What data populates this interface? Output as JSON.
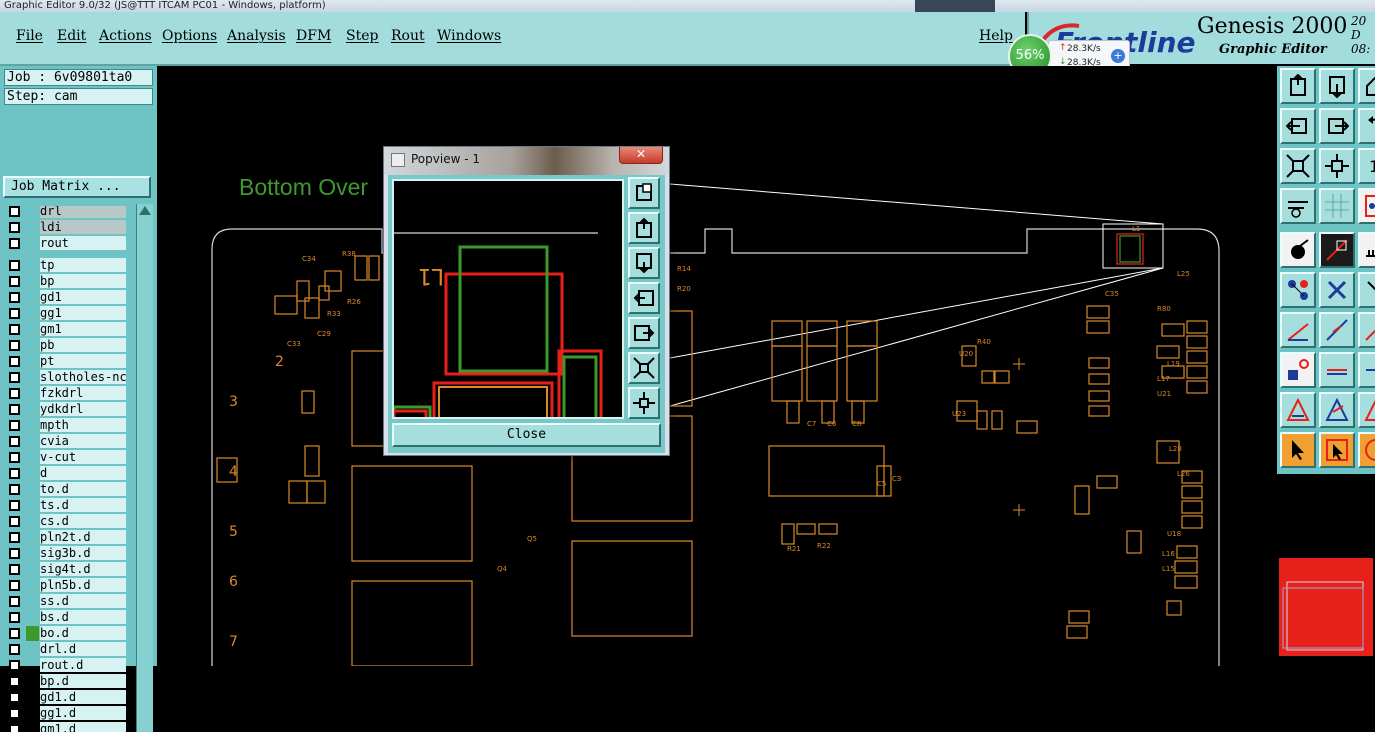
{
  "window": {
    "title": "Graphic Editor 9.0/32 (JS@TTT ITCAM PC01 - Windows, platform)"
  },
  "menu": {
    "items": [
      "File",
      "Edit",
      "Actions",
      "Options",
      "Analysis",
      "DFM",
      "Step",
      "Rout",
      "Windows"
    ],
    "help": "Help"
  },
  "brand": {
    "logo": "Frontline",
    "title": "Genesis 2000",
    "subtitle": "Graphic Editor",
    "date_line1": "20 D",
    "date_line2": "08:"
  },
  "speed_meter": {
    "percent": "56%",
    "up": "28.3K/s",
    "down": "28.3K/s"
  },
  "job": {
    "job_label": "Job : 6v09801ta0",
    "step_label": "Step: cam",
    "matrix_button": "Job Matrix ..."
  },
  "layers": [
    {
      "name": "drl",
      "active": true
    },
    {
      "name": "ldi",
      "active": true
    },
    {
      "name": "rout",
      "active": false
    },
    {
      "name": "tp"
    },
    {
      "name": "bp"
    },
    {
      "name": "gd1"
    },
    {
      "name": "gg1"
    },
    {
      "name": "gm1"
    },
    {
      "name": "pb"
    },
    {
      "name": "pt"
    },
    {
      "name": "slotholes-nc"
    },
    {
      "name": "fzkdrl"
    },
    {
      "name": "ydkdrl"
    },
    {
      "name": "mpth"
    },
    {
      "name": "cvia"
    },
    {
      "name": "v-cut"
    },
    {
      "name": "d"
    },
    {
      "name": "to.d"
    },
    {
      "name": "ts.d"
    },
    {
      "name": "cs.d"
    },
    {
      "name": "pln2t.d"
    },
    {
      "name": "sig3b.d"
    },
    {
      "name": "sig4t.d"
    },
    {
      "name": "pln5b.d"
    },
    {
      "name": "ss.d"
    },
    {
      "name": "bs.d"
    },
    {
      "name": "bo.d",
      "color": "#3c9a2a"
    },
    {
      "name": "drl.d"
    },
    {
      "name": "rout.d"
    },
    {
      "name": "bp.d"
    },
    {
      "name": "gd1.d"
    },
    {
      "name": "gg1.d"
    },
    {
      "name": "gm1.d"
    }
  ],
  "canvas": {
    "layer_label": "Bottom Over",
    "row_numbers": [
      "2",
      "3",
      "4",
      "5",
      "6",
      "7"
    ],
    "refdes": [
      "R38",
      "C34",
      "R33",
      "C33",
      "R26",
      "C29",
      "Q5",
      "Q4",
      "R21",
      "L1",
      "C5",
      "C7",
      "C6",
      "C8",
      "R14",
      "R20",
      "U20",
      "U23",
      "L25",
      "L19",
      "L17",
      "U21",
      "R22",
      "C3",
      "R40",
      "L26",
      "R80",
      "C35",
      "L28",
      "U18",
      "L16",
      "L15"
    ]
  },
  "popview": {
    "title": "Popview - 1",
    "close_x": "✕",
    "close_button": "Close",
    "view_label": "L1"
  },
  "colors": {
    "panel": "#6ec4c4",
    "menubar": "#a2dcdc",
    "pcb_orange": "#d98a2a",
    "pcb_red": "#e8201a",
    "pcb_green": "#3c9a2a"
  }
}
